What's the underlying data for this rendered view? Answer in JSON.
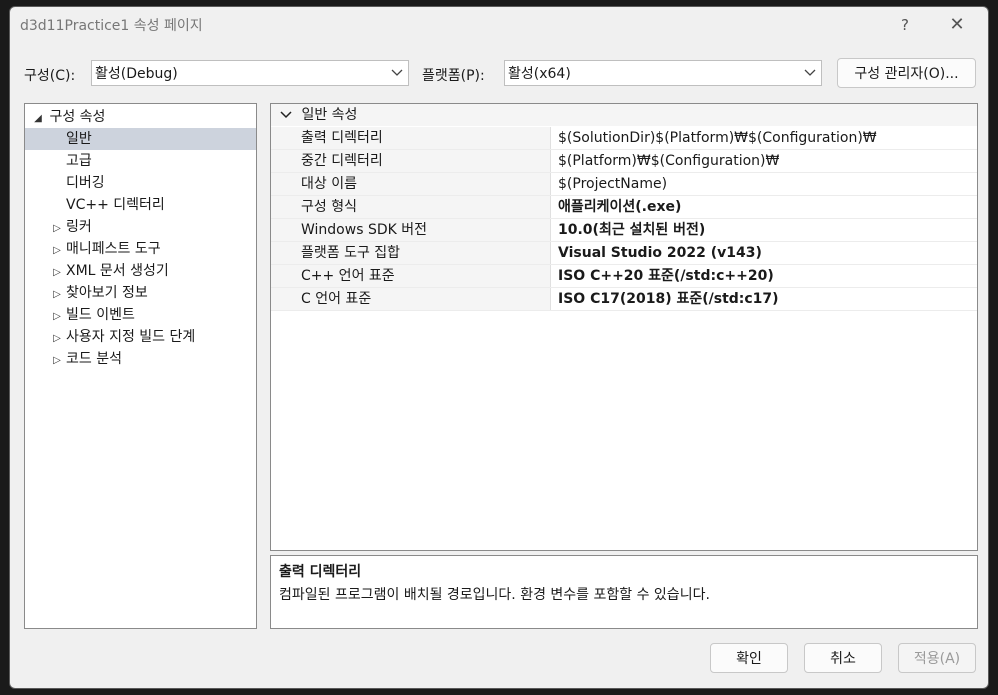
{
  "window": {
    "title": "d3d11Practice1 속성 페이지",
    "help_glyph": "?",
    "close_glyph": "✕"
  },
  "config_bar": {
    "config_label": "구성(C):",
    "config_value": "활성(Debug)",
    "platform_label": "플랫폼(P):",
    "platform_value": "활성(x64)",
    "manager_button": "구성 관리자(O)..."
  },
  "tree": {
    "root": "구성 속성",
    "items": [
      {
        "label": "일반",
        "selected": true,
        "expandable": false
      },
      {
        "label": "고급",
        "selected": false,
        "expandable": false
      },
      {
        "label": "디버깅",
        "selected": false,
        "expandable": false
      },
      {
        "label": "VC++ 디렉터리",
        "selected": false,
        "expandable": false
      },
      {
        "label": "링커",
        "selected": false,
        "expandable": true
      },
      {
        "label": "매니페스트 도구",
        "selected": false,
        "expandable": true
      },
      {
        "label": "XML 문서 생성기",
        "selected": false,
        "expandable": true
      },
      {
        "label": "찾아보기 정보",
        "selected": false,
        "expandable": true
      },
      {
        "label": "빌드 이벤트",
        "selected": false,
        "expandable": true
      },
      {
        "label": "사용자 지정 빌드 단계",
        "selected": false,
        "expandable": true
      },
      {
        "label": "코드 분석",
        "selected": false,
        "expandable": true
      }
    ]
  },
  "grid": {
    "category": "일반 속성",
    "rows": [
      {
        "name": "출력 디렉터리",
        "value": "$(SolutionDir)$(Platform)₩$(Configuration)₩",
        "bold": false
      },
      {
        "name": "중간 디렉터리",
        "value": "$(Platform)₩$(Configuration)₩",
        "bold": false
      },
      {
        "name": "대상 이름",
        "value": "$(ProjectName)",
        "bold": false
      },
      {
        "name": "구성 형식",
        "value": "애플리케이션(.exe)",
        "bold": true
      },
      {
        "name": "Windows SDK 버전",
        "value": "10.0(최근 설치된 버전)",
        "bold": true
      },
      {
        "name": "플랫폼 도구 집합",
        "value": "Visual Studio 2022 (v143)",
        "bold": true
      },
      {
        "name": "C++ 언어 표준",
        "value": "ISO C++20 표준(/std:c++20)",
        "bold": true
      },
      {
        "name": "C 언어 표준",
        "value": "ISO C17(2018) 표준(/std:c17)",
        "bold": true
      }
    ]
  },
  "description": {
    "title": "출력 디렉터리",
    "text": "컴파일된 프로그램이 배치될 경로입니다. 환경 변수를 포함할 수 있습니다."
  },
  "buttons": {
    "ok": "확인",
    "cancel": "취소",
    "apply": "적용(A)"
  }
}
